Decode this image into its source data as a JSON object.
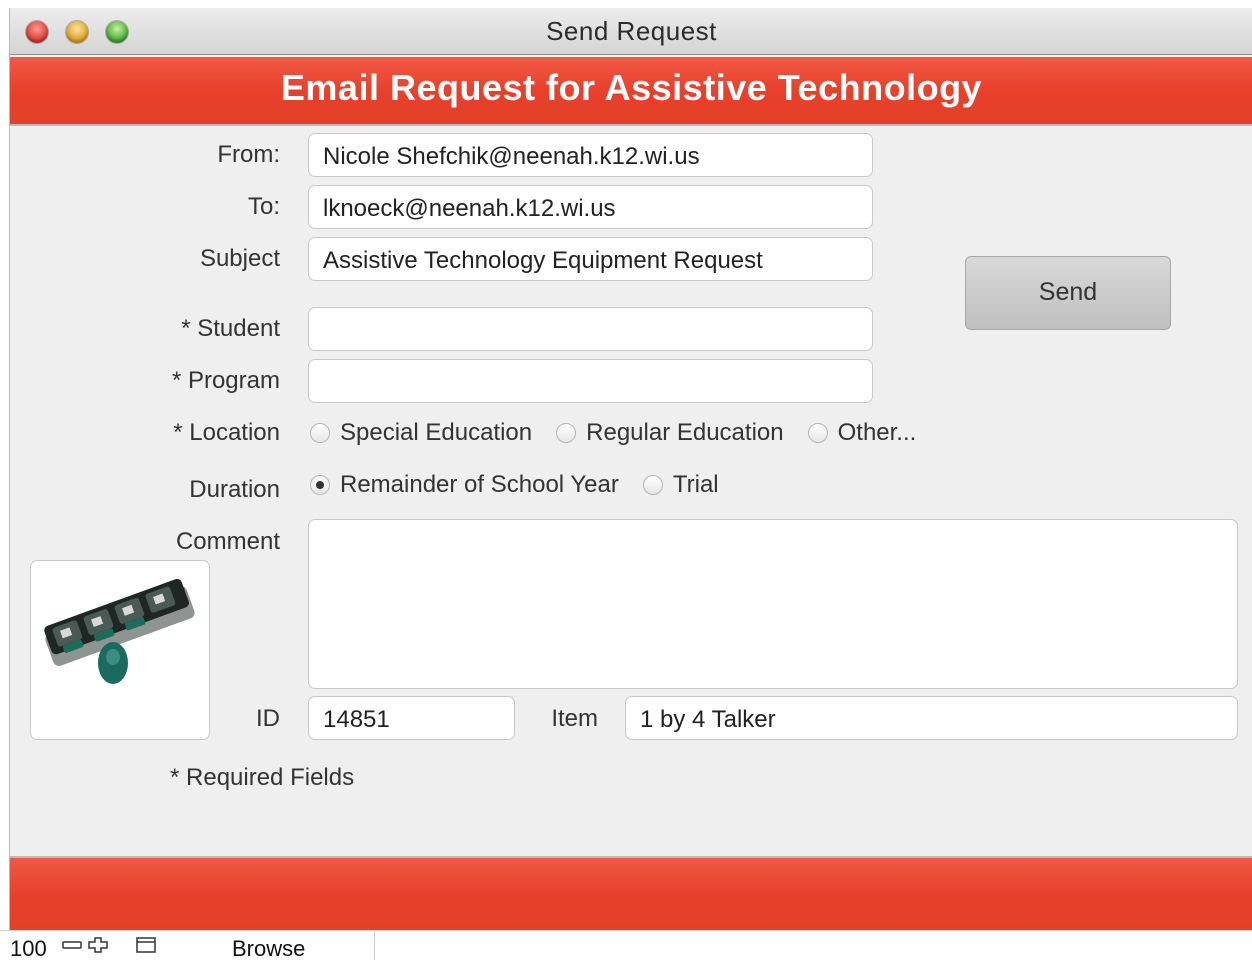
{
  "window": {
    "title": "Send Request"
  },
  "banner": {
    "title": "Email Request for Assistive Technology"
  },
  "form": {
    "from_label": "From:",
    "from_value": "Nicole Shefchik@neenah.k12.wi.us",
    "to_label": "To:",
    "to_value": "lknoeck@neenah.k12.wi.us",
    "subject_label": "Subject",
    "subject_value": "Assistive Technology Equipment Request",
    "student_label": "* Student",
    "student_value": "",
    "program_label": "* Program",
    "program_value": "",
    "location_label": "* Location",
    "location_options": [
      {
        "label": "Special Education",
        "checked": false
      },
      {
        "label": "Regular Education",
        "checked": false
      },
      {
        "label": "Other...",
        "checked": false
      }
    ],
    "duration_label": "Duration",
    "duration_options": [
      {
        "label": "Remainder of School Year",
        "checked": true
      },
      {
        "label": "Trial",
        "checked": false
      }
    ],
    "comment_label": "Comment",
    "comment_value": "",
    "id_label": "ID",
    "id_value": "14851",
    "item_label": "Item",
    "item_value": "1 by 4 Talker",
    "required_note": "* Required Fields",
    "send_label": "Send"
  },
  "statusbar": {
    "zoom": "100",
    "mode": "Browse",
    "icons": [
      "zoom-out-icon",
      "zoom-in-icon",
      "toggle-status-area-icon"
    ]
  },
  "colors": {
    "accent": "#e8402b",
    "window_bg": "#efefef"
  }
}
